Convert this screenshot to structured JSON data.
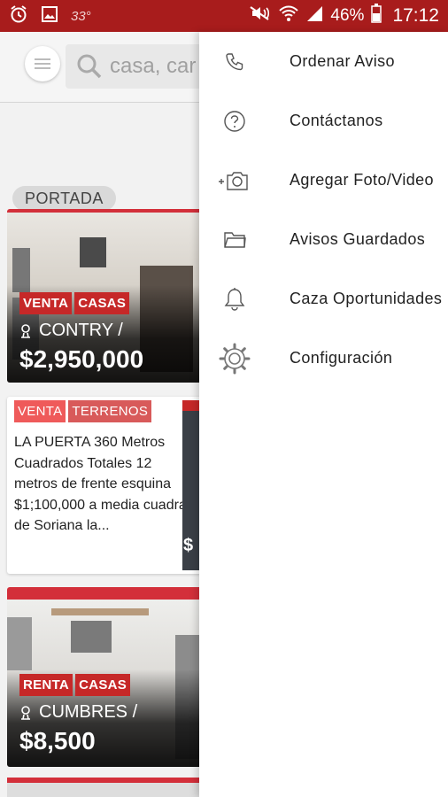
{
  "status_bar": {
    "temperature": "33°",
    "battery": "46%",
    "time": "17:12"
  },
  "search": {
    "placeholder": "casa, car"
  },
  "section": {
    "label": "PORTADA"
  },
  "listings": [
    {
      "tags": [
        "VENTA",
        "CASAS"
      ],
      "location": "CONTRY /",
      "price": "$2,950,000"
    },
    {
      "tags": [
        "VENTA",
        "TERRENOS"
      ],
      "description": "LA PUERTA 360 Metros Cuadrados Totales 12 metros de frente esquina $1;100,000 a media cuadra de Soriana la...",
      "thumb_letter": "$"
    },
    {
      "tags": [
        "RENTA",
        "CASAS"
      ],
      "location": "CUMBRES /",
      "price": "$8,500"
    }
  ],
  "drawer": {
    "items": [
      {
        "label": "Ordenar Aviso",
        "icon": "phone-icon"
      },
      {
        "label": "Contáctanos",
        "icon": "help-icon"
      },
      {
        "label": "Agregar Foto/Video",
        "icon": "add-camera-icon"
      },
      {
        "label": "Avisos Guardados",
        "icon": "folder-icon"
      },
      {
        "label": "Caza Oportunidades",
        "icon": "bell-icon"
      },
      {
        "label": "Configuración",
        "icon": "gear-icon"
      }
    ]
  },
  "colors": {
    "brand_red": "#a81c1c",
    "tag_red": "#c62828"
  }
}
